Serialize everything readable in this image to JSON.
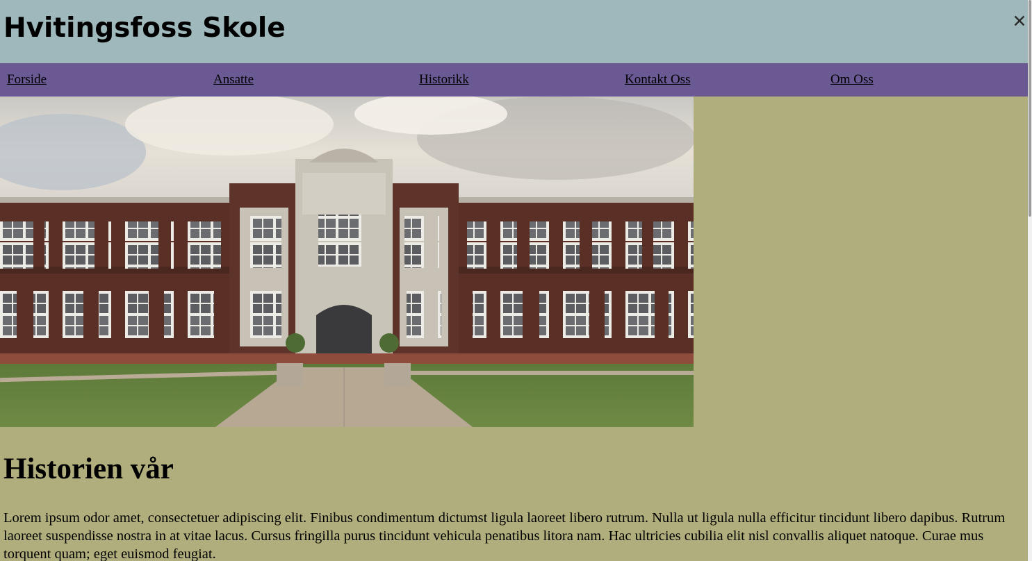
{
  "header": {
    "title": "Hvitingsfoss Skole",
    "close_icon": "close-icon",
    "close_glyph": "✕",
    "background_color": "#9fb8bb"
  },
  "nav": {
    "background_color": "#6a5993",
    "items": [
      {
        "label": "Forside"
      },
      {
        "label": "Ansatte"
      },
      {
        "label": "Historikk"
      },
      {
        "label": "Kontakt Oss"
      },
      {
        "label": "Om Oss"
      }
    ]
  },
  "hero": {
    "image": "school-building-photo"
  },
  "content": {
    "heading": "Historien vår",
    "body": "Lorem ipsum odor amet, consectetuer adipiscing elit. Finibus condimentum dictumst ligula laoreet libero rutrum. Nulla ut ligula nulla efficitur tincidunt libero dapibus. Rutrum laoreet suspendisse nostra in at vitae lacus. Cursus fringilla purus tincidunt vehicula penatibus litora nam. Hac ultricies cubilia elit nisl convallis aliquet natoque. Curae mus torquent quam; eget euismod feugiat.",
    "background_color": "#b1ae7d"
  }
}
